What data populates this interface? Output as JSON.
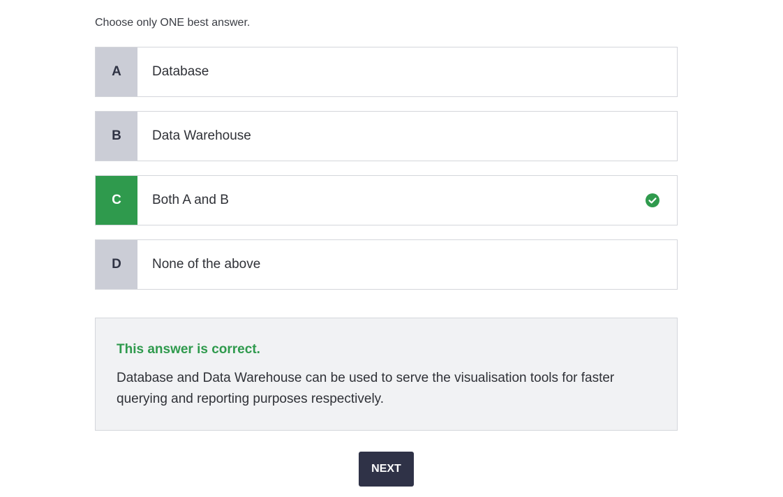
{
  "quiz": {
    "instruction": "Choose only ONE best answer.",
    "options": [
      {
        "letter": "A",
        "text": "Database",
        "state": "default"
      },
      {
        "letter": "B",
        "text": "Data Warehouse",
        "state": "default"
      },
      {
        "letter": "C",
        "text": "Both A and B",
        "state": "correct",
        "icon": "check-circle-icon"
      },
      {
        "letter": "D",
        "text": "None of the above",
        "state": "default"
      }
    ],
    "feedback": {
      "title": "This answer is correct.",
      "body": "Database and Data Warehouse can be used to serve the visualisation tools for faster querying and reporting purposes respectively."
    },
    "next_label": "NEXT"
  },
  "colors": {
    "correct_green": "#2f9a4d",
    "letter_bg": "#cbcdd6",
    "feedback_bg": "#f1f2f4",
    "button_bg": "#2f3247"
  }
}
